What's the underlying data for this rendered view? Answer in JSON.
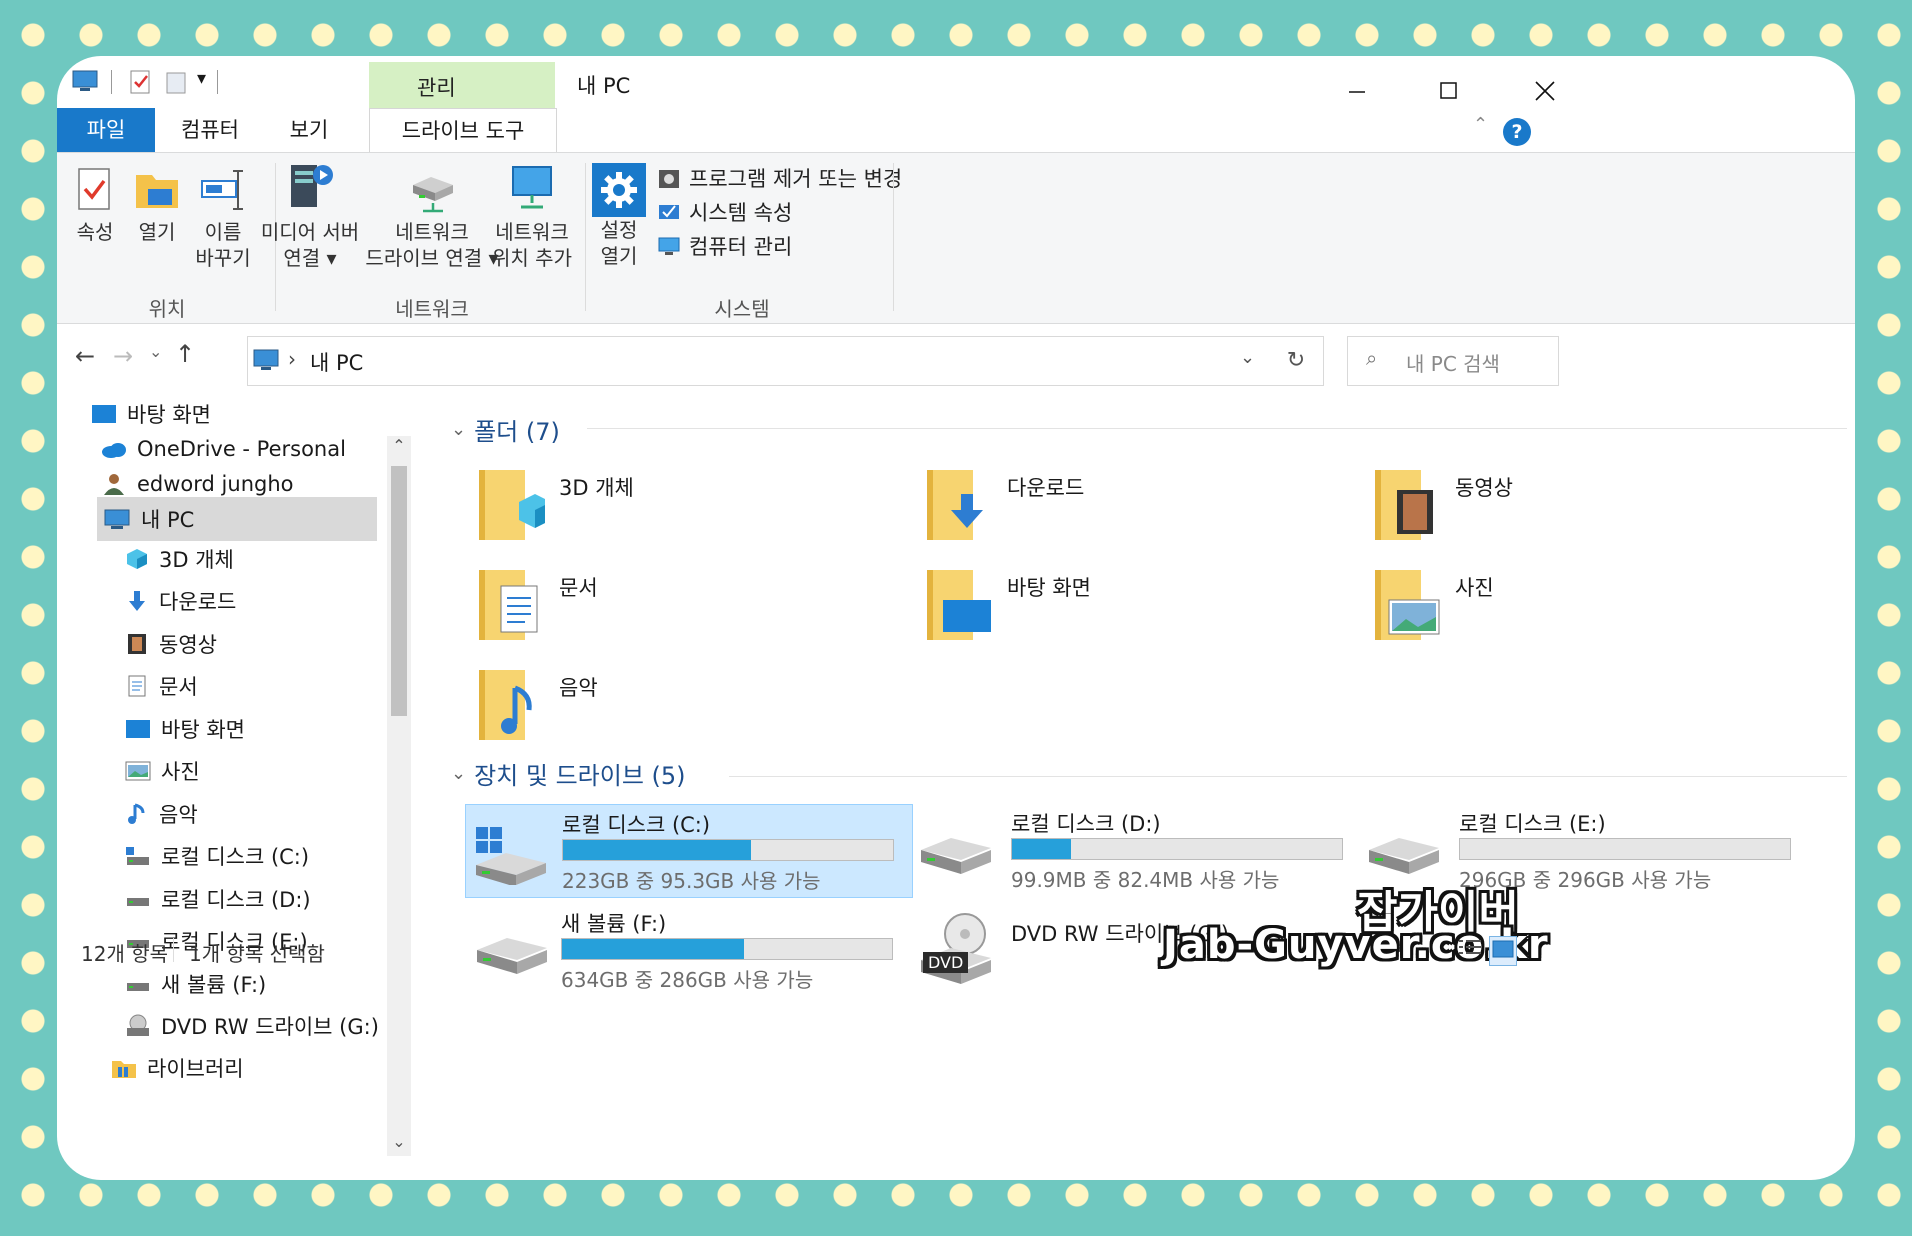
{
  "window": {
    "title": "내 PC",
    "context_tab": "관리",
    "tabs": [
      "파일",
      "컴퓨터",
      "보기",
      "드라이브 도구"
    ]
  },
  "ribbon": {
    "location": {
      "label": "위치",
      "buttons": [
        {
          "label": "속성",
          "icon": "properties-icon"
        },
        {
          "label": "열기",
          "icon": "open-folder-icon"
        },
        {
          "label1": "이름",
          "label2": "바꾸기",
          "icon": "rename-icon"
        }
      ]
    },
    "network": {
      "label": "네트워크",
      "buttons": [
        {
          "label1": "미디어 서버",
          "label2": "연결 ▾",
          "icon": "media-server-icon"
        },
        {
          "label1": "네트워크",
          "label2": "드라이브 연결 ▾",
          "icon": "network-drive-icon"
        },
        {
          "label1": "네트워크",
          "label2": "위치 추가",
          "icon": "network-location-icon"
        }
      ]
    },
    "system": {
      "label": "시스템",
      "settings": {
        "label1": "설정",
        "label2": "열기",
        "icon": "settings-gear-icon"
      },
      "items": [
        "프로그램 제거 또는 변경",
        "시스템 속성",
        "컴퓨터 관리"
      ]
    }
  },
  "address": {
    "path": "내 PC",
    "search_placeholder": "내 PC 검색"
  },
  "nav": {
    "items": [
      {
        "label": "바탕 화면",
        "icon": "desktop-icon"
      },
      {
        "label": "OneDrive - Personal",
        "icon": "onedrive-cloud-icon"
      },
      {
        "label": "edword jungho",
        "icon": "user-icon"
      },
      {
        "label": "내 PC",
        "icon": "this-pc-icon"
      },
      {
        "label": "3D 개체",
        "icon": "3d-objects-icon"
      },
      {
        "label": "다운로드",
        "icon": "download-icon"
      },
      {
        "label": "동영상",
        "icon": "videos-icon"
      },
      {
        "label": "문서",
        "icon": "documents-icon"
      },
      {
        "label": "바탕 화면",
        "icon": "desktop-icon"
      },
      {
        "label": "사진",
        "icon": "pictures-icon"
      },
      {
        "label": "음악",
        "icon": "music-icon"
      },
      {
        "label": "로컬 디스크 (C:)",
        "icon": "system-drive-icon"
      },
      {
        "label": "로컬 디스크 (D:)",
        "icon": "drive-icon"
      },
      {
        "label": "로컬 디스크 (E:)",
        "icon": "drive-icon"
      },
      {
        "label": "새 볼륨 (F:)",
        "icon": "drive-icon"
      },
      {
        "label": "DVD RW 드라이브 (G:)",
        "icon": "dvd-drive-icon"
      },
      {
        "label": "라이브러리",
        "icon": "library-icon"
      }
    ]
  },
  "folders": {
    "header": "폴더 (7)",
    "items": [
      {
        "label": "3D 개체",
        "icon": "3d-objects-folder-icon"
      },
      {
        "label": "다운로드",
        "icon": "downloads-folder-icon"
      },
      {
        "label": "동영상",
        "icon": "videos-folder-icon"
      },
      {
        "label": "문서",
        "icon": "documents-folder-icon"
      },
      {
        "label": "바탕 화면",
        "icon": "desktop-folder-icon"
      },
      {
        "label": "사진",
        "icon": "pictures-folder-icon"
      },
      {
        "label": "음악",
        "icon": "music-folder-icon"
      }
    ]
  },
  "drives": {
    "header": "장치 및 드라이브 (5)",
    "items": [
      {
        "label": "로컬 디스크 (C:)",
        "free": "223GB 중 95.3GB 사용 가능",
        "used_fraction": 0.57
      },
      {
        "label": "로컬 디스크 (D:)",
        "free": "99.9MB 중 82.4MB 사용 가능",
        "used_fraction": 0.18
      },
      {
        "label": "로컬 디스크 (E:)",
        "free": "296GB 중 296GB 사용 가능",
        "used_fraction": 0.0
      },
      {
        "label": "새 볼륨 (F:)",
        "free": "634GB 중 286GB 사용 가능",
        "used_fraction": 0.55
      },
      {
        "label": "DVD RW 드라이브 (G:)",
        "badge": "DVD"
      }
    ]
  },
  "status": {
    "count": "12개 항목",
    "selected": "1개 항목 선택함"
  },
  "watermark": {
    "line1": "잡가이버",
    "line2": "Jab-Guyver.co.kr"
  },
  "colors": {
    "accent": "#1979ca",
    "bar_fill": "#26a0da",
    "selection": "#cce8ff",
    "manage_tab": "#d6f0c4"
  }
}
